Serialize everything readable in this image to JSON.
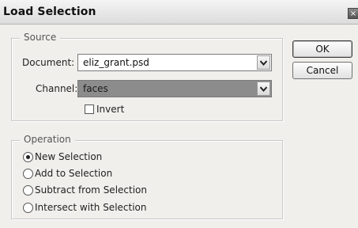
{
  "window": {
    "title": "Load Selection",
    "close_glyph": "×"
  },
  "source": {
    "legend": "Source",
    "document_label": "Document:",
    "document_value": "eliz_grant.psd",
    "channel_label": "Channel:",
    "channel_value": "faces",
    "invert_label": "Invert",
    "invert_checked": false
  },
  "operation": {
    "legend": "Operation",
    "options": [
      {
        "label": "New Selection",
        "selected": true
      },
      {
        "label": "Add to Selection",
        "selected": false
      },
      {
        "label": "Subtract from Selection",
        "selected": false
      },
      {
        "label": "Intersect with Selection",
        "selected": false
      }
    ]
  },
  "buttons": {
    "ok": "OK",
    "cancel": "Cancel"
  }
}
